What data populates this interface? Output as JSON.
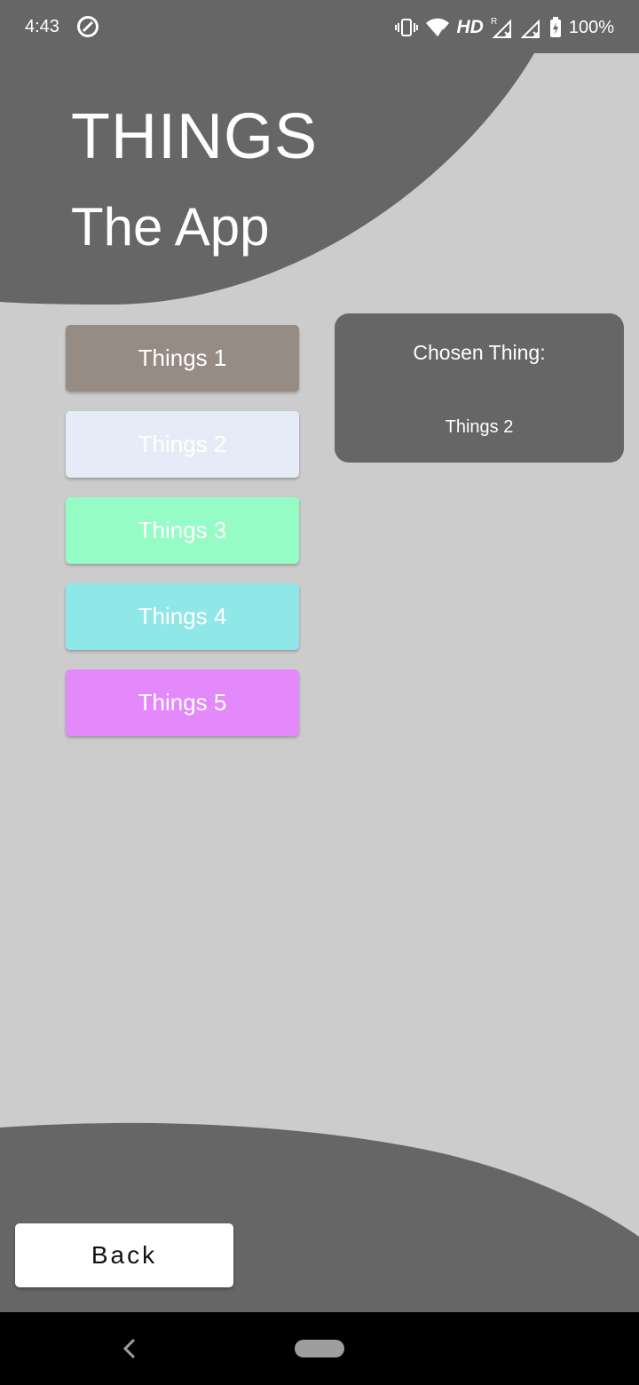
{
  "status_bar": {
    "time": "4:43",
    "network_label": "HD",
    "battery": "100%",
    "icons": [
      "app-notification-icon",
      "vibrate-icon",
      "wifi-icon",
      "signal-r-icon",
      "signal-x-icon",
      "battery-charging-icon"
    ]
  },
  "header": {
    "title": "THINGS",
    "subtitle": "The App"
  },
  "things": [
    {
      "label": "Things 1",
      "color": "#978c84"
    },
    {
      "label": "Things 2",
      "color": "#e6ecf7"
    },
    {
      "label": "Things 3",
      "color": "#96fcc6"
    },
    {
      "label": "Things 4",
      "color": "#8fe7e7"
    },
    {
      "label": "Things 5",
      "color": "#e489fc"
    }
  ],
  "chosen": {
    "label": "Chosen Thing:",
    "value": "Things 2"
  },
  "footer": {
    "back_label": "Back"
  },
  "theme": {
    "background": "#cccccc",
    "shape": "#666666"
  }
}
